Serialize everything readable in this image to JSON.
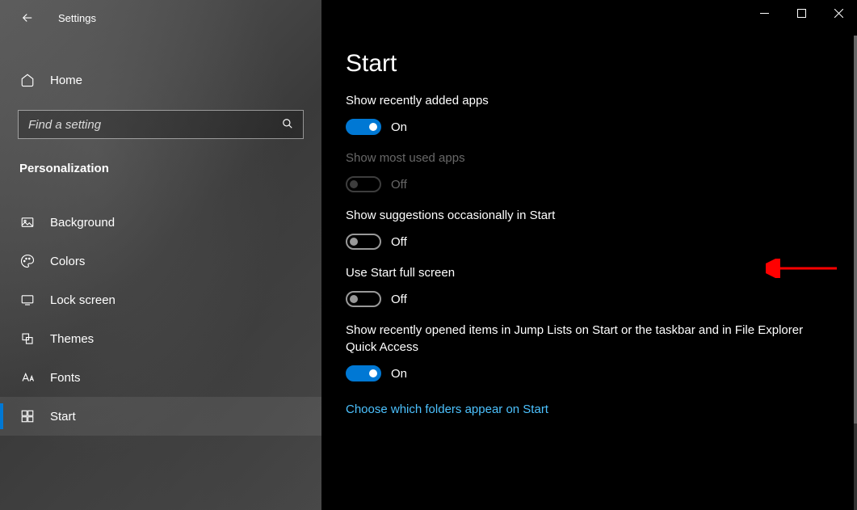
{
  "header": {
    "app_title": "Settings"
  },
  "sidebar": {
    "home_label": "Home",
    "search_placeholder": "Find a setting",
    "category": "Personalization",
    "items": [
      {
        "label": "Background",
        "selected": false
      },
      {
        "label": "Colors",
        "selected": false
      },
      {
        "label": "Lock screen",
        "selected": false
      },
      {
        "label": "Themes",
        "selected": false
      },
      {
        "label": "Fonts",
        "selected": false
      },
      {
        "label": "Start",
        "selected": true
      }
    ]
  },
  "main": {
    "title": "Start",
    "settings": [
      {
        "label": "Show recently added apps",
        "on": true,
        "state": "On",
        "disabled": false
      },
      {
        "label": "Show most used apps",
        "on": false,
        "state": "Off",
        "disabled": true
      },
      {
        "label": "Show suggestions occasionally in Start",
        "on": false,
        "state": "Off",
        "disabled": false
      },
      {
        "label": "Use Start full screen",
        "on": false,
        "state": "Off",
        "disabled": false
      },
      {
        "label": "Show recently opened items in Jump Lists on Start or the taskbar and in File Explorer Quick Access",
        "on": true,
        "state": "On",
        "disabled": false
      }
    ],
    "link": "Choose which folders appear on Start"
  }
}
